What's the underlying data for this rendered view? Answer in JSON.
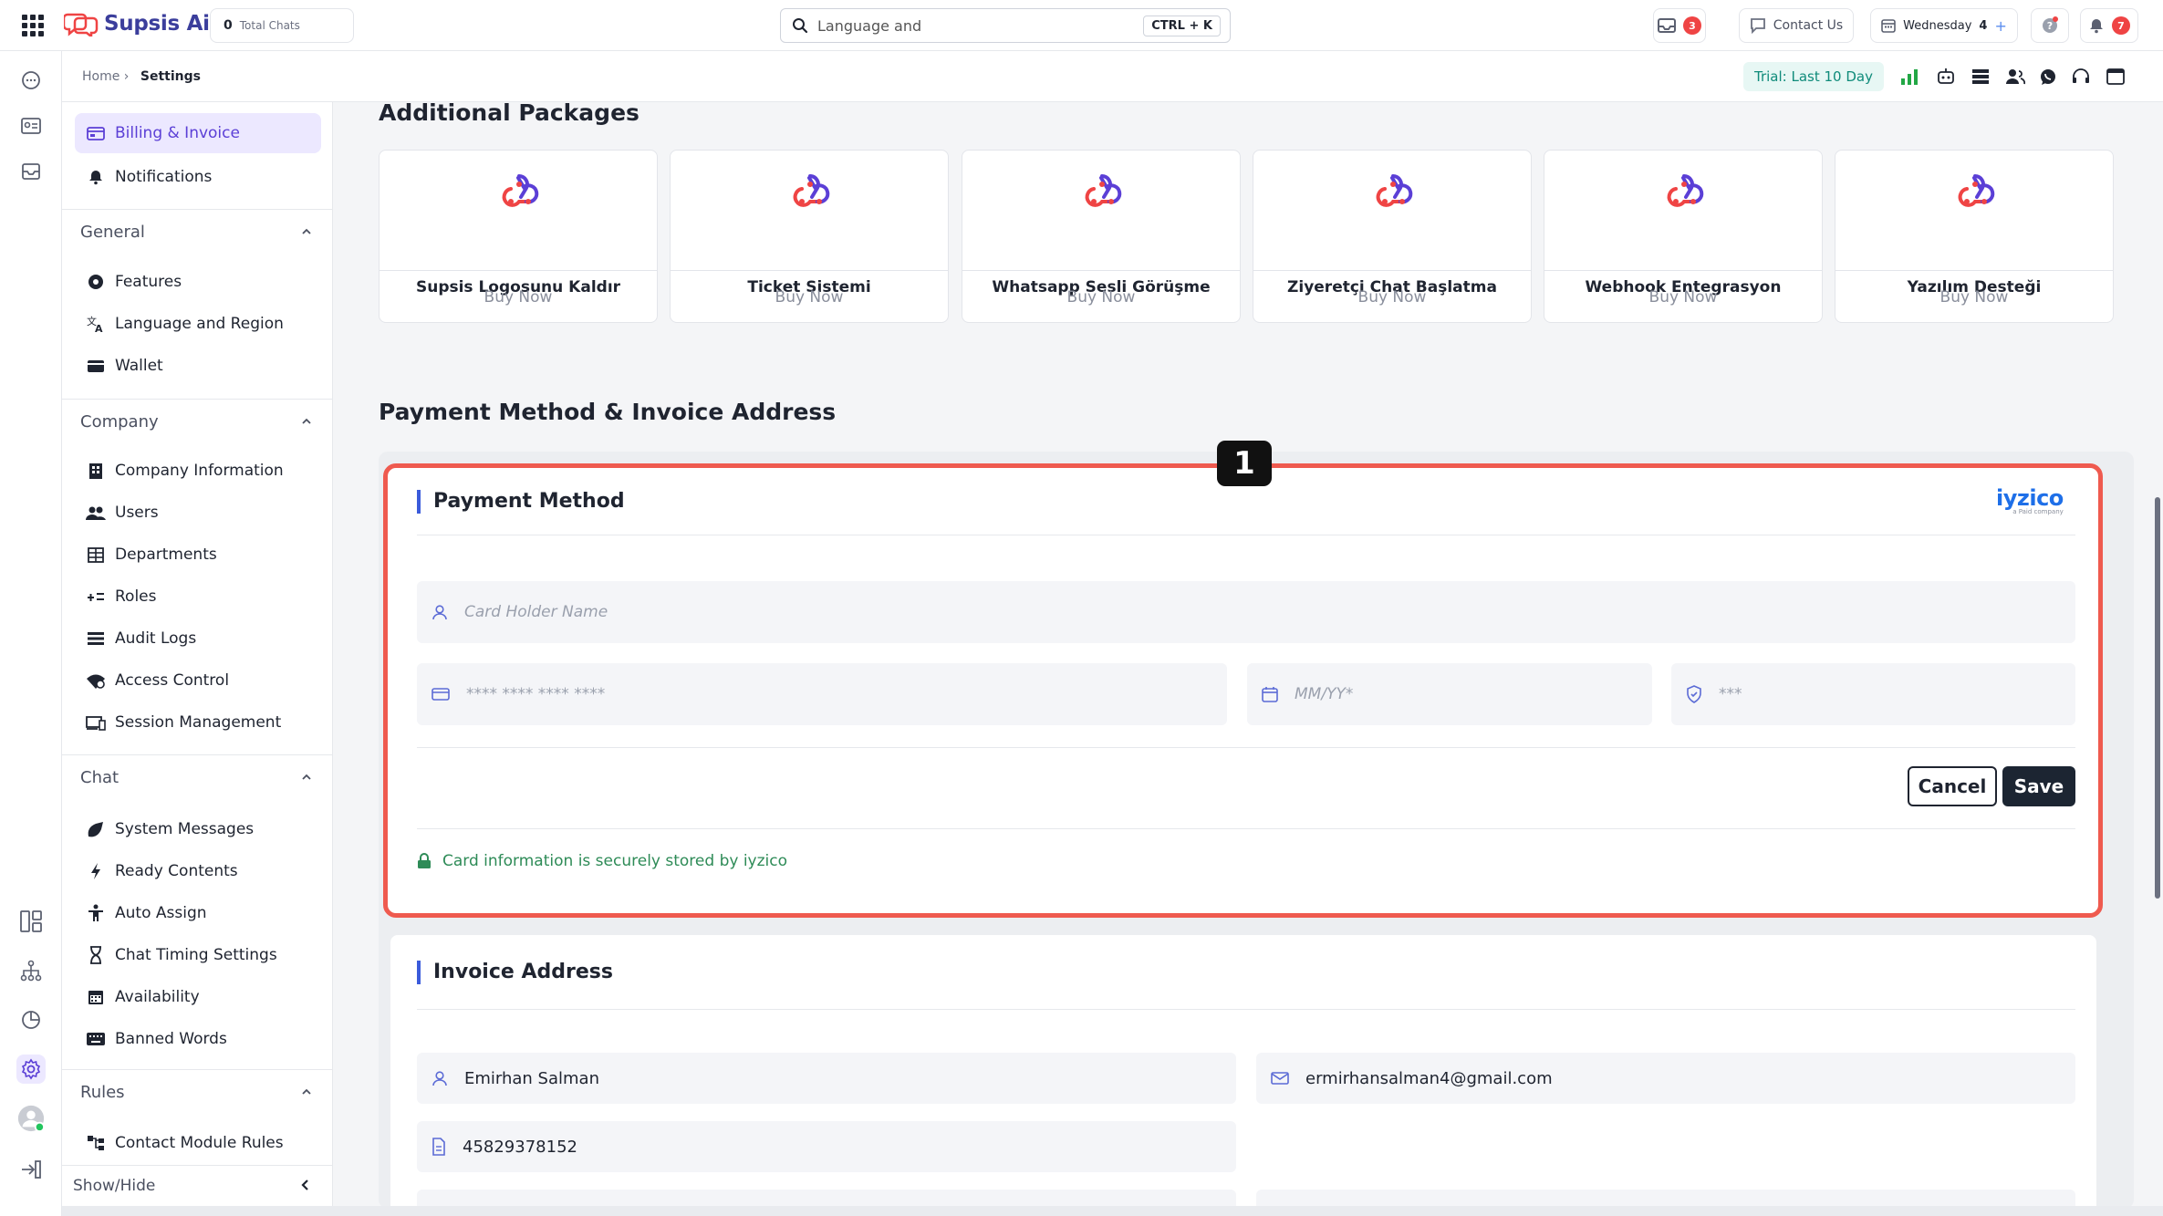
{
  "app": {
    "name": "Supsis Ai",
    "total_chats_count": "0",
    "total_chats_label": "Total Chats"
  },
  "topbar": {
    "search_value": "Language and",
    "search_shortcut": "CTRL + K",
    "inbox_badge": "3",
    "contact_us": "Contact Us",
    "day_label": "Wednesday",
    "day_number": "4",
    "notifications_badge": "7"
  },
  "breadcrumb": {
    "home": "Home ›",
    "current": "Settings"
  },
  "trial": "Trial: Last 10 Day",
  "sidebar": {
    "top_items": [
      {
        "label": "Billing & Invoice",
        "active": true
      },
      {
        "label": "Notifications"
      }
    ],
    "sections": [
      {
        "title": "General",
        "items": [
          "Features",
          "Language and Region",
          "Wallet"
        ]
      },
      {
        "title": "Company",
        "items": [
          "Company Information",
          "Users",
          "Departments",
          "Roles",
          "Audit Logs",
          "Access Control",
          "Session Management"
        ]
      },
      {
        "title": "Chat",
        "items": [
          "System Messages",
          "Ready Contents",
          "Auto Assign",
          "Chat Timing Settings",
          "Availability",
          "Banned Words"
        ]
      },
      {
        "title": "Rules",
        "items": [
          "Contact Module Rules"
        ]
      }
    ],
    "show_hide": "Show/Hide"
  },
  "main": {
    "additional_packages_title": "Additional Packages",
    "packages": [
      {
        "name": "Supsis Logosunu Kaldır",
        "cta": "Buy Now"
      },
      {
        "name": "Ticket Sistemi",
        "cta": "Buy Now"
      },
      {
        "name": "Whatsapp Sesli Görüşme",
        "cta": "Buy Now"
      },
      {
        "name": "Ziyeretçi Chat Başlatma",
        "cta": "Buy Now"
      },
      {
        "name": "Webhook Entegrasyon",
        "cta": "Buy Now"
      },
      {
        "name": "Yazılım Desteği",
        "cta": "Buy Now"
      }
    ],
    "payment_section_title": "Payment Method & Invoice Address",
    "annotation_marker": "1",
    "payment": {
      "title": "Payment Method",
      "provider_logo": "iyzico",
      "provider_logo_sub": "a Paid company",
      "card_holder_placeholder": "Card Holder Name",
      "card_number_placeholder": "**** **** **** ****",
      "expiry_placeholder": "MM/YY*",
      "cvc_placeholder": "***",
      "cancel": "Cancel",
      "save": "Save",
      "secure_note": "Card information is securely stored by iyzico"
    },
    "invoice": {
      "title": "Invoice Address",
      "name": "Emirhan Salman",
      "email": "ermirhansalman4@gmail.com",
      "tax_number": "45829378152"
    }
  },
  "colors": {
    "accent": "#5b3fd6",
    "highlight": "#ef5a4f",
    "secure_text": "#2e8b57",
    "iyzico": "#1e6fe8",
    "badge": "#ef4444"
  }
}
